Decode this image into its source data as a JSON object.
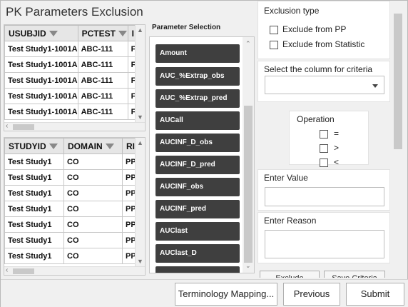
{
  "title": "PK Parameters Exclusion",
  "top_grid": {
    "columns": [
      "USUBJID",
      "PCTEST",
      "I"
    ],
    "rows": [
      [
        "Test Study1-1001A",
        "ABC-111",
        "F"
      ],
      [
        "Test Study1-1001A",
        "ABC-111",
        "F"
      ],
      [
        "Test Study1-1001A",
        "ABC-111",
        "F"
      ],
      [
        "Test Study1-1001A",
        "ABC-111",
        "F"
      ],
      [
        "Test Study1-1001A",
        "ABC-111",
        "F"
      ]
    ]
  },
  "bottom_grid": {
    "columns": [
      "STUDYID",
      "DOMAIN",
      "RI"
    ],
    "rows": [
      [
        "Test Study1",
        "CO",
        "PP"
      ],
      [
        "Test Study1",
        "CO",
        "PP"
      ],
      [
        "Test Study1",
        "CO",
        "PP"
      ],
      [
        "Test Study1",
        "CO",
        "PP"
      ],
      [
        "Test Study1",
        "CO",
        "PP"
      ],
      [
        "Test Study1",
        "CO",
        "PP"
      ],
      [
        "Test Study1",
        "CO",
        "PP"
      ]
    ]
  },
  "parameter_selection": {
    "label": "Parameter Selection",
    "items": [
      "Amount",
      "AUC_%Extrap_obs",
      "AUC_%Extrap_pred",
      "AUCall",
      "AUCINF_D_obs",
      "AUCINF_D_pred",
      "AUCINF_obs",
      "AUCINF_pred",
      "AUClast",
      "AUClast_D"
    ]
  },
  "exclusion": {
    "label": "Exclusion type",
    "options": [
      "Exclude from PP",
      "Exclude from Statistic"
    ]
  },
  "column_criteria": {
    "label": "Select the column for criteria",
    "value": ""
  },
  "operation": {
    "label": "Operation",
    "options": [
      "=",
      ">",
      "<"
    ]
  },
  "enter_value": {
    "label": "Enter Value",
    "value": ""
  },
  "enter_reason": {
    "label": "Enter Reason",
    "value": ""
  },
  "right_buttons": {
    "exclude": "Exclude",
    "save_criteria": "Save Criteria"
  },
  "footer": {
    "terminology": "Terminology Mapping...",
    "previous": "Previous",
    "submit": "Submit"
  }
}
